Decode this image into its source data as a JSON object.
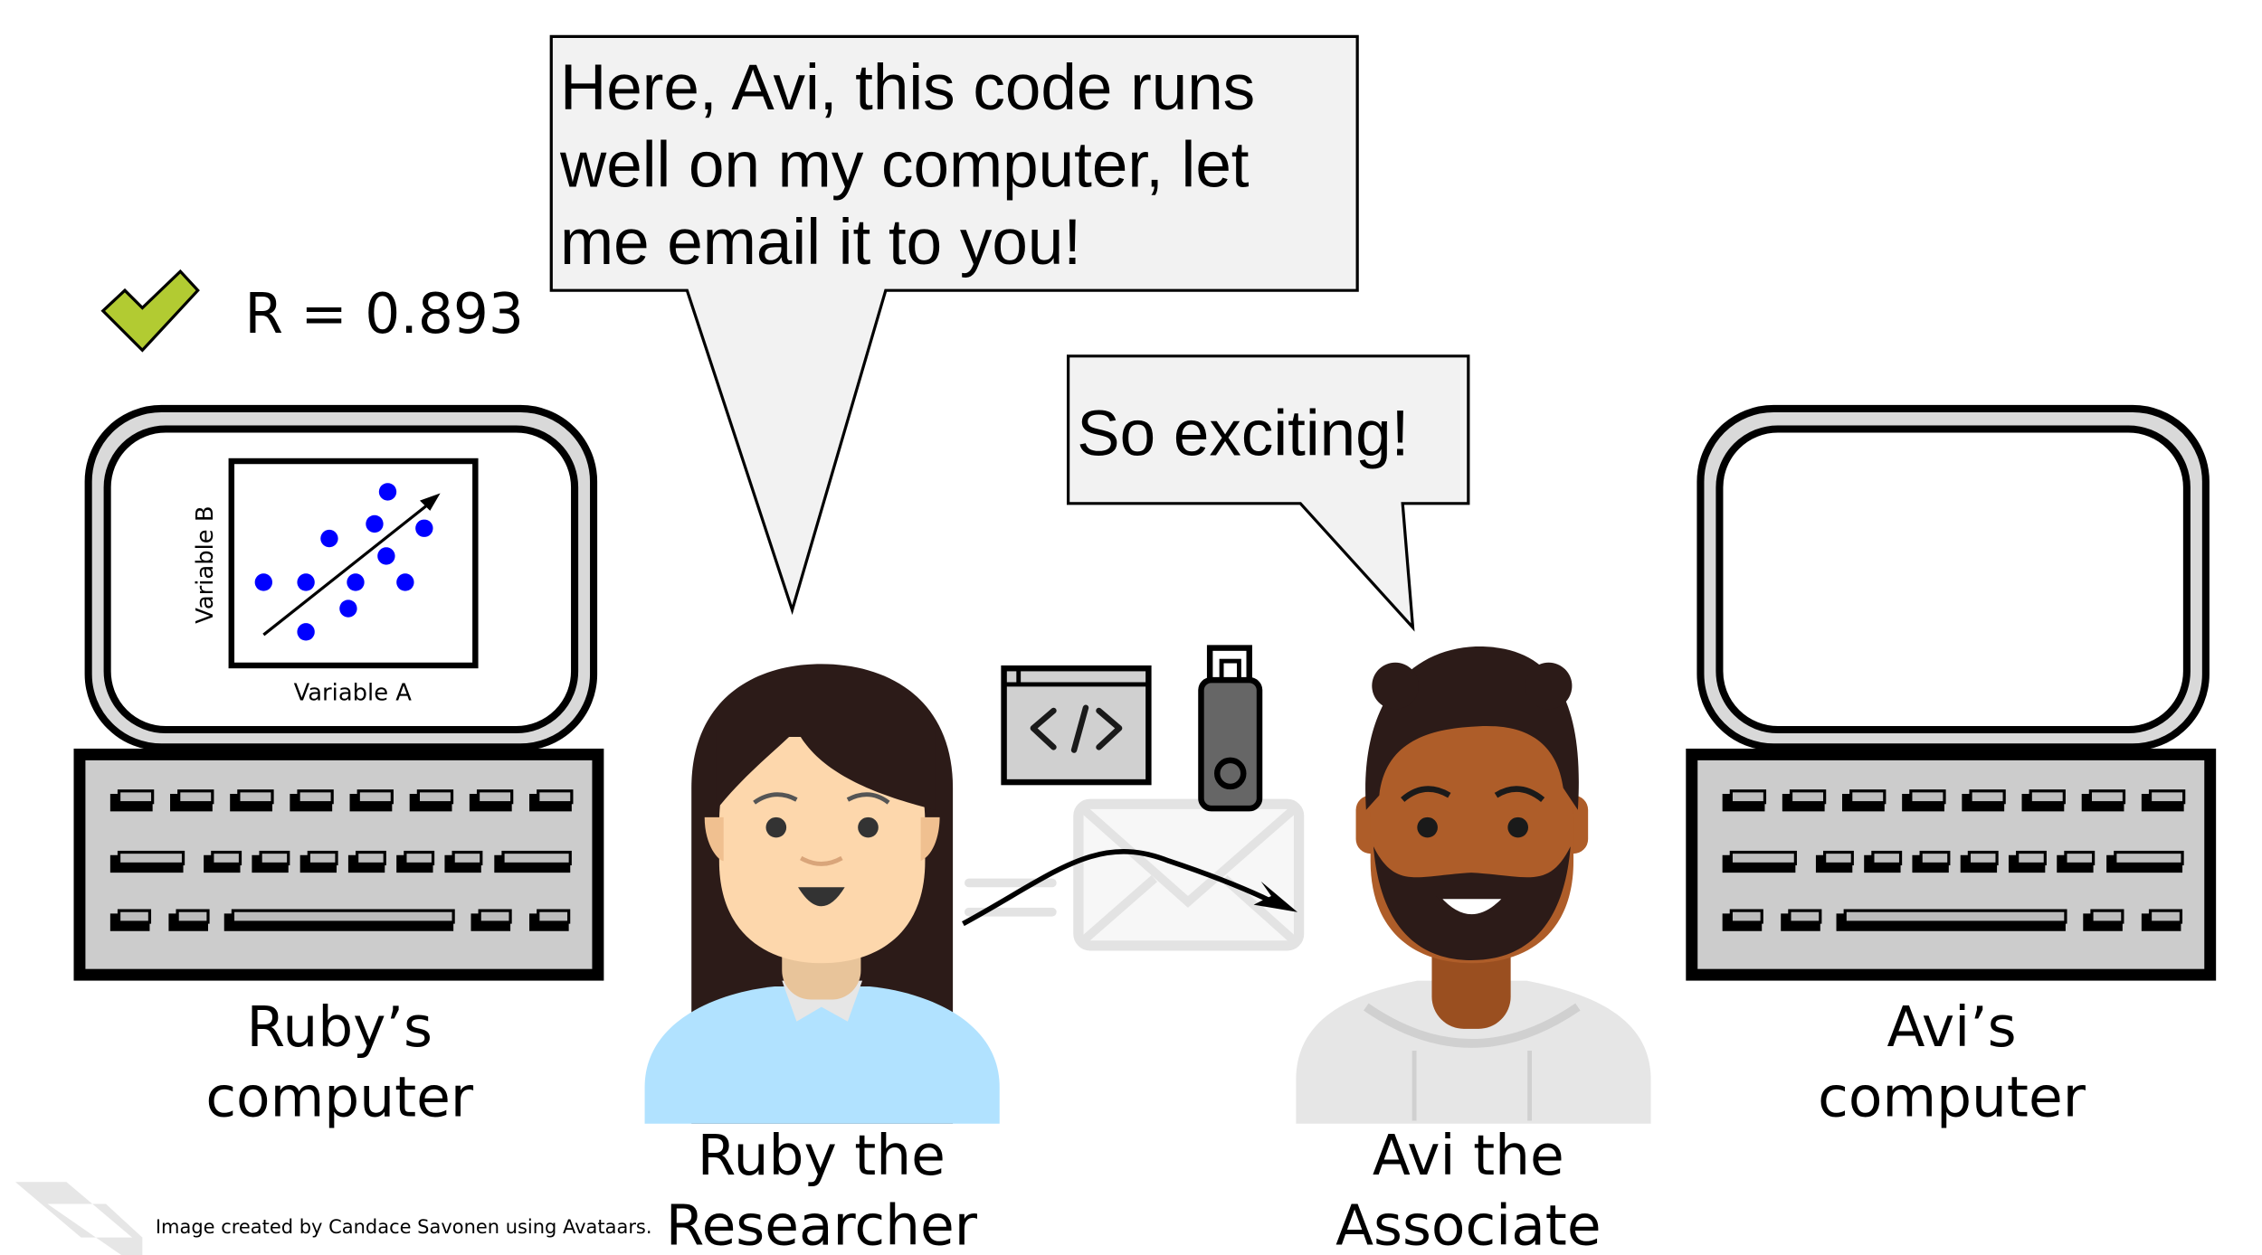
{
  "result": {
    "text": "R = 0.893",
    "icon": "checkmark-icon",
    "color": "#b2cb32"
  },
  "bubble_ruby": {
    "lines": [
      "Here, Avi, this code runs",
      "well on my computer, let",
      "me email it to you!"
    ]
  },
  "bubble_avi": {
    "text": "So exciting!"
  },
  "ruby_computer": {
    "label_lines": [
      "Ruby’s",
      "computer"
    ],
    "plot": {
      "xlabel": "Variable A",
      "ylabel": "Variable B",
      "point_color": "#0000ff"
    }
  },
  "avi_computer": {
    "label_lines": [
      "Avi’s",
      "computer"
    ]
  },
  "ruby": {
    "name_lines": [
      "Ruby the",
      "Researcher"
    ],
    "skin": "#fdd7ac",
    "hair": "#2c1b18",
    "shirt": "#b1e2ff"
  },
  "avi": {
    "name_lines": [
      "Avi the",
      "Associate"
    ],
    "skin": "#ae5d29",
    "hair": "#2c1b18",
    "hoodie": "#e6e6e6"
  },
  "transfer_icons": [
    "code-window-icon",
    "usb-drive-icon",
    "envelope-icon"
  ],
  "credit": "Image created by Candace Savonen using Avataars."
}
